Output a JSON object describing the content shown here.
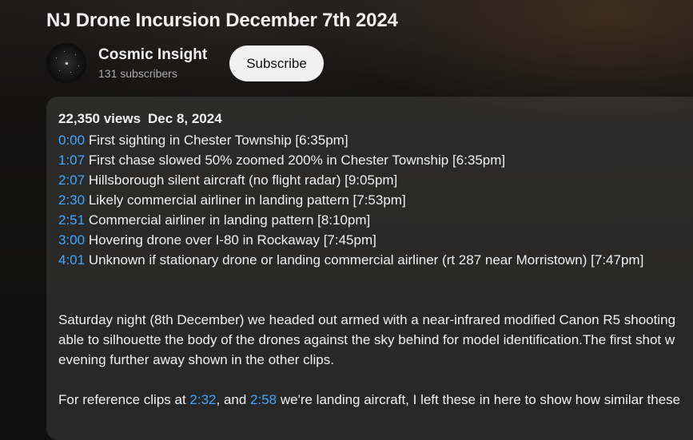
{
  "video": {
    "title": "NJ Drone Incursion December 7th 2024"
  },
  "channel": {
    "name": "Cosmic Insight",
    "subscribers": "131 subscribers",
    "subscribe_label": "Subscribe"
  },
  "description": {
    "views": "22,350 views",
    "date": "Dec 8, 2024",
    "chapters": [
      {
        "time": "0:00",
        "text": "First sighting in Chester Township [6:35pm]"
      },
      {
        "time": "1:07",
        "text": "First chase slowed 50% zoomed 200% in Chester Township [6:35pm]"
      },
      {
        "time": "2:07",
        "text": "Hillsborough silent aircraft (no flight radar) [9:05pm]"
      },
      {
        "time": "2:30",
        "text": "Likely commercial airliner in landing pattern [7:53pm]"
      },
      {
        "time": "2:51",
        "text": "Commercial airliner in landing pattern [8:10pm]"
      },
      {
        "time": "3:00",
        "text": "Hovering drone over I-80 in Rockaway [7:45pm]"
      },
      {
        "time": "4:01",
        "text": "Unknown if stationary drone or landing commercial airliner (rt 287 near Morristown) [7:47pm]"
      }
    ],
    "paragraph1": [
      "Saturday night (8th December) we headed out armed with a near-infrared modified Canon R5 shooting",
      "able to silhouette the body of the drones against the sky behind for model identification.The first shot w",
      "evening further away shown in the other clips."
    ],
    "paragraph2": {
      "prefix": "For reference clips at ",
      "link1": "2:32",
      "middle": ", and ",
      "link2": "2:58",
      "suffix": " we're landing aircraft, I left these in here to show how similar these"
    }
  },
  "colors": {
    "link": "#3ea6ff",
    "text": "#f1f1f1",
    "secondary_text": "#aaaaaa",
    "subscribe_bg": "#f1f1f1",
    "page_bg": "#0f0f0f"
  }
}
